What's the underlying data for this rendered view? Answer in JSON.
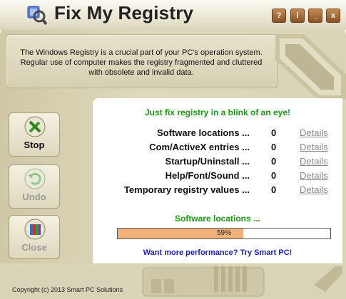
{
  "window": {
    "title": "Fix My Registry",
    "controls": {
      "help": "?",
      "info": "i",
      "minimize": "_",
      "close": "x"
    }
  },
  "info": {
    "text": "The Windows Registry is a crucial part of your PC's operation system. Regular use of computer makes the registry fragmented and cluttered with obsolete and invalid data."
  },
  "sidebar": {
    "stop": {
      "label": "Stop",
      "icon": "tools-icon"
    },
    "undo": {
      "label": "Undo",
      "icon": "undo-icon"
    },
    "close": {
      "label": "Close",
      "icon": "books-icon"
    }
  },
  "main": {
    "headline": "Just fix registry in a blink of an eye!",
    "rows": [
      {
        "name": "Software locations ...",
        "count": "0",
        "details": "Details"
      },
      {
        "name": "Com/ActiveX entries ...",
        "count": "0",
        "details": "Details"
      },
      {
        "name": "Startup/Uninstall ...",
        "count": "0",
        "details": "Details"
      },
      {
        "name": "Help/Font/Sound ...",
        "count": "0",
        "details": "Details"
      },
      {
        "name": "Temporary registry values ...",
        "count": "0",
        "details": "Details"
      }
    ],
    "status": "Software locations ...",
    "progress": {
      "percent": 59,
      "text": "59%"
    },
    "promo": "Want more performance? Try Smart PC!"
  },
  "footer": {
    "copyright": "Copyright (c) 2013 Smart PC Solutions"
  },
  "colors": {
    "green_text": "#1a9a12",
    "promo_blue": "#1a1ab8",
    "progress_fill": "#f0b27a",
    "frame": "#d9d3b7"
  }
}
